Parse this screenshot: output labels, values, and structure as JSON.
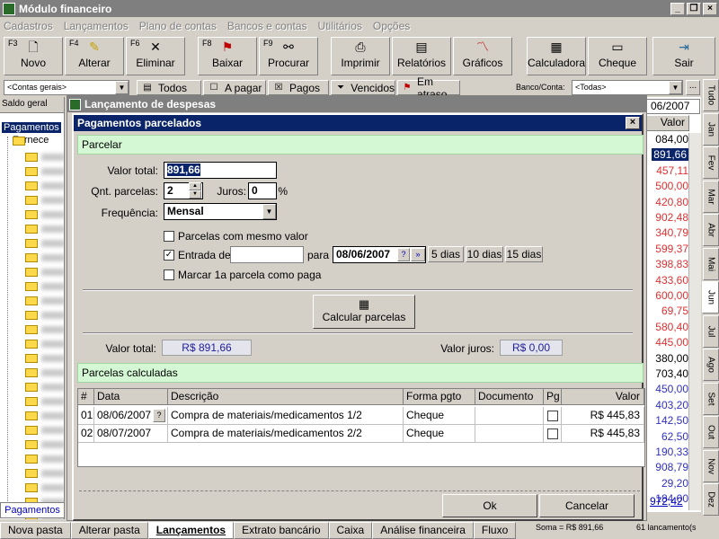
{
  "app": {
    "title": "Módulo financeiro"
  },
  "menu": [
    "Cadastros",
    "Lançamentos",
    "Plano de contas",
    "Bancos e contas",
    "Utilitários",
    "Opções"
  ],
  "toolbar": [
    {
      "key": "F3",
      "label": "Novo",
      "icon": "new-document-icon"
    },
    {
      "key": "F4",
      "label": "Alterar",
      "icon": "edit-icon"
    },
    {
      "key": "F6",
      "label": "Eliminar",
      "icon": "delete-icon"
    },
    {
      "key": "F8",
      "label": "Baixar",
      "icon": "flag-icon"
    },
    {
      "key": "F9",
      "label": "Procurar",
      "icon": "binoculars-icon"
    },
    {
      "key": "",
      "label": "Imprimir",
      "icon": "printer-icon"
    },
    {
      "key": "",
      "label": "Relatórios",
      "icon": "reports-icon"
    },
    {
      "key": "",
      "label": "Gráficos",
      "icon": "chart-icon"
    },
    {
      "key": "",
      "label": "Calculadora",
      "icon": "calculator-icon"
    },
    {
      "key": "",
      "label": "Cheque",
      "icon": "check-icon"
    },
    {
      "key": "",
      "label": "Sair",
      "icon": "exit-icon"
    }
  ],
  "filter": {
    "accounts_combo": "<Contas gerais>",
    "buttons": [
      "Todos",
      "A pagar",
      "Pagos",
      "Vencidos",
      "Em atraso"
    ],
    "bank_label": "Banco/Conta:",
    "bank_combo": "<Todas>"
  },
  "left": {
    "saldo": "Saldo geral",
    "root": "Pagamentos",
    "child": "Fornece",
    "bottom_tab": "Pagamentos"
  },
  "right": {
    "date": "06/2007",
    "header": "Valor",
    "values": [
      "084,00",
      "891,66",
      "457,11",
      "500,00",
      "420,80",
      "902,48",
      "340,79",
      "599,37",
      "398,83",
      "433,60",
      "600,00",
      "69,75",
      "580,40",
      "445,00",
      "380,00",
      "703,40",
      "450,00",
      "403,20",
      "142,50",
      "62,50",
      "190,33",
      "908,79",
      "29,20",
      "184,00"
    ],
    "footer": "972,42"
  },
  "months": [
    "Tudo",
    "Jan",
    "Fev",
    "Mar",
    "Abr",
    "Mai",
    "Jun",
    "Jul",
    "Ago",
    "Set",
    "Out",
    "Nov",
    "Dez"
  ],
  "bottom_tabs": [
    "Nova pasta",
    "Alterar pasta",
    "Lançamentos",
    "Extrato bancário",
    "Caixa",
    "Análise financeira",
    "Fluxo"
  ],
  "status": {
    "soma": "Soma = R$ 891,66",
    "count": "61 lancamento(s"
  },
  "bg_window": {
    "title": "Lançamento de despesas"
  },
  "dialog": {
    "title": "Pagamentos parcelados",
    "section_parcelar": "Parcelar",
    "valor_total_label": "Valor total:",
    "valor_total": "891,66",
    "qnt_label": "Qnt. parcelas:",
    "qnt": "2",
    "juros_label": "Juros:",
    "juros": "0",
    "juros_unit": "%",
    "freq_label": "Frequência:",
    "freq": "Mensal",
    "chk_mesmo_valor": "Parcelas com mesmo valor",
    "chk_entrada": "Entrada de",
    "para_label": "para",
    "para_date": "08/06/2007",
    "day_buttons": [
      "5 dias",
      "10 dias",
      "15 dias"
    ],
    "chk_marcar": "Marcar 1a parcela como paga",
    "calc_button": "Calcular parcelas",
    "total_label": "Valor total:",
    "total_value": "R$  891,66",
    "juros_value_label": "Valor juros:",
    "juros_value": "R$  0,00",
    "section_calc": "Parcelas calculadas",
    "columns": [
      "#",
      "Data",
      "Descrição",
      "Forma pgto",
      "Documento",
      "Pg",
      "Valor"
    ],
    "rows": [
      {
        "n": "01",
        "data": "08/06/2007",
        "desc": "Compra de materiais/medicamentos 1/2",
        "forma": "Cheque",
        "doc": "",
        "valor": "R$  445,83"
      },
      {
        "n": "02",
        "data": "08/07/2007",
        "desc": "Compra de materiais/medicamentos 2/2",
        "forma": "Cheque",
        "doc": "",
        "valor": "R$  445,83"
      }
    ],
    "ok": "Ok",
    "cancel": "Cancelar"
  }
}
